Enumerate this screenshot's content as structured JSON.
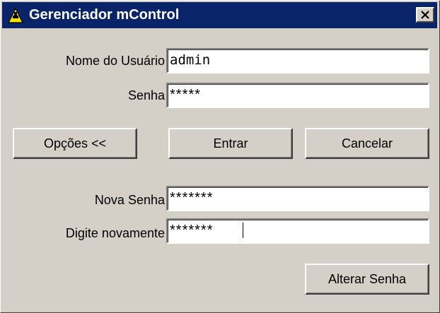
{
  "window": {
    "title": "Gerenciador mControl",
    "icon": "mcontrol-app-icon",
    "close_icon": "close-icon",
    "titlebar_color": "#0a246a",
    "background_color": "#d4d0c8"
  },
  "login": {
    "username_label": "Nome do Usuário",
    "username_value": "admin",
    "password_label": "Senha",
    "password_value": "*****"
  },
  "buttons": {
    "options_label": "Opções <<",
    "enter_label": "Entrar",
    "cancel_label": "Cancelar",
    "change_password_label": "Alterar Senha"
  },
  "change_password": {
    "new_password_label": "Nova Senha",
    "new_password_value": "*******",
    "confirm_label": "Digite novamente",
    "confirm_value": "*******"
  }
}
